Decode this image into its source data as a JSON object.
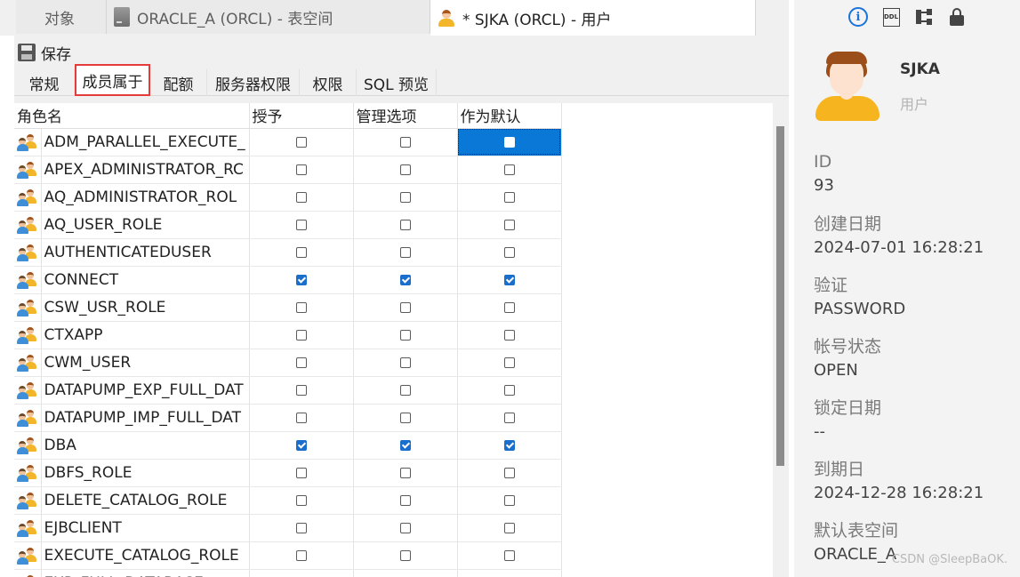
{
  "doc_tabs": [
    {
      "label": "对象"
    },
    {
      "label": "ORACLE_A (ORCL) - 表空间"
    },
    {
      "label": "* SJKA (ORCL) - 用户"
    }
  ],
  "toolbar": {
    "save_label": "保存"
  },
  "sub_tabs": [
    {
      "label": "常规"
    },
    {
      "label": "成员属于",
      "active": true
    },
    {
      "label": "配额"
    },
    {
      "label": "服务器权限"
    },
    {
      "label": "权限"
    },
    {
      "label": "SQL 预览"
    }
  ],
  "grid": {
    "columns": [
      "角色名",
      "授予",
      "管理选项",
      "作为默认"
    ],
    "rows": [
      {
        "name": "ADM_PARALLEL_EXECUTE_",
        "grant": false,
        "admin": false,
        "default": false
      },
      {
        "name": "APEX_ADMINISTRATOR_RC",
        "grant": false,
        "admin": false,
        "default": false
      },
      {
        "name": "AQ_ADMINISTRATOR_ROL",
        "grant": false,
        "admin": false,
        "default": false
      },
      {
        "name": "AQ_USER_ROLE",
        "grant": false,
        "admin": false,
        "default": false
      },
      {
        "name": "AUTHENTICATEDUSER",
        "grant": false,
        "admin": false,
        "default": false
      },
      {
        "name": "CONNECT",
        "grant": true,
        "admin": true,
        "default": true
      },
      {
        "name": "CSW_USR_ROLE",
        "grant": false,
        "admin": false,
        "default": false
      },
      {
        "name": "CTXAPP",
        "grant": false,
        "admin": false,
        "default": false
      },
      {
        "name": "CWM_USER",
        "grant": false,
        "admin": false,
        "default": false
      },
      {
        "name": "DATAPUMP_EXP_FULL_DAT",
        "grant": false,
        "admin": false,
        "default": false
      },
      {
        "name": "DATAPUMP_IMP_FULL_DAT",
        "grant": false,
        "admin": false,
        "default": false
      },
      {
        "name": "DBA",
        "grant": true,
        "admin": true,
        "default": true
      },
      {
        "name": "DBFS_ROLE",
        "grant": false,
        "admin": false,
        "default": false
      },
      {
        "name": "DELETE_CATALOG_ROLE",
        "grant": false,
        "admin": false,
        "default": false
      },
      {
        "name": "EJBCLIENT",
        "grant": false,
        "admin": false,
        "default": false
      },
      {
        "name": "EXECUTE_CATALOG_ROLE",
        "grant": false,
        "admin": false,
        "default": false
      },
      {
        "name": "EXP_FULL_DATABASE",
        "grant": false,
        "admin": false,
        "default": false
      }
    ]
  },
  "info": {
    "icons": [
      "info-icon",
      "ddl-icon",
      "dependency-tree-icon",
      "lock-icon"
    ],
    "ddl_icon_text": "DDL",
    "info_icon_text": "i",
    "user_name": "SJKA",
    "user_type": "用户",
    "props": [
      {
        "label": "ID",
        "value": "93"
      },
      {
        "label": "创建日期",
        "value": "2024-07-01 16:28:21"
      },
      {
        "label": "验证",
        "value": "PASSWORD"
      },
      {
        "label": "帐号状态",
        "value": "OPEN"
      },
      {
        "label": "锁定日期",
        "value": "--"
      },
      {
        "label": "到期日",
        "value": "2024-12-28 16:28:21"
      },
      {
        "label": "默认表空间",
        "value": "ORACLE_A"
      }
    ]
  },
  "watermark": "CSDN @SleepBaOK.",
  "colors": {
    "accent": "#0a78d7",
    "active_tab_border": "#e63b3b",
    "checkbox_on": "#1a6fcc"
  }
}
